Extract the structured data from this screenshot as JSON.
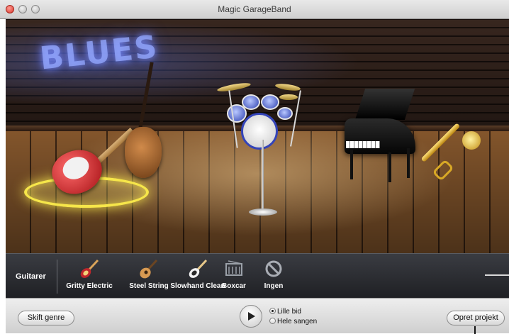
{
  "window": {
    "title": "Magic GarageBand"
  },
  "stage": {
    "neon_sign": "BLUES",
    "selected_instrument": "guitar"
  },
  "selector": {
    "category": "Guitarer",
    "options": [
      {
        "label": "Gritty Electric",
        "icon": "electric-guitar-icon",
        "selected": false
      },
      {
        "label": "Steel String",
        "icon": "acoustic-guitar-icon",
        "selected": false
      },
      {
        "label": "Slowhand Clean",
        "icon": "clean-electric-guitar-icon",
        "selected": false
      },
      {
        "label": "Boxcar",
        "icon": "boxcar-amp-icon",
        "selected": false
      },
      {
        "label": "Ingen",
        "icon": "none-icon",
        "selected": false
      }
    ]
  },
  "toolbar": {
    "genre_button": "Skift genre",
    "play_icon": "play-icon",
    "radio_options": [
      {
        "label": "Lille bid",
        "checked": true
      },
      {
        "label": "Hele sangen",
        "checked": false
      }
    ],
    "create_button": "Opret projekt"
  }
}
